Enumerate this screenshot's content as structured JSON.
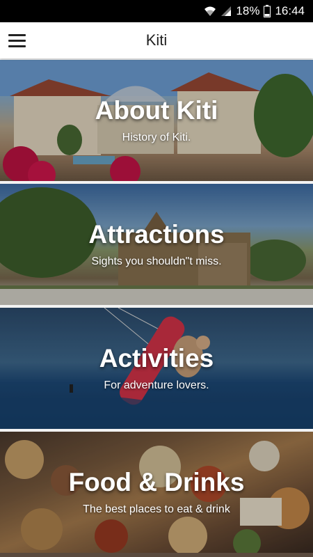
{
  "status_bar": {
    "battery": "18%",
    "time": "16:44"
  },
  "app_bar": {
    "title": "Kiti",
    "menu_icon": "hamburger-menu-icon"
  },
  "cards": [
    {
      "title": "About Kiti",
      "subtitle": "History of Kiti."
    },
    {
      "title": "Attractions",
      "subtitle": "Sights you shouldn\"t miss."
    },
    {
      "title": "Activities",
      "subtitle": "For adventure lovers."
    },
    {
      "title": "Food & Drinks",
      "subtitle": "The best places to eat & drink"
    }
  ],
  "colors": {
    "status_bar": "#000000",
    "app_bar": "#ffffff",
    "card_text": "#ffffff"
  }
}
